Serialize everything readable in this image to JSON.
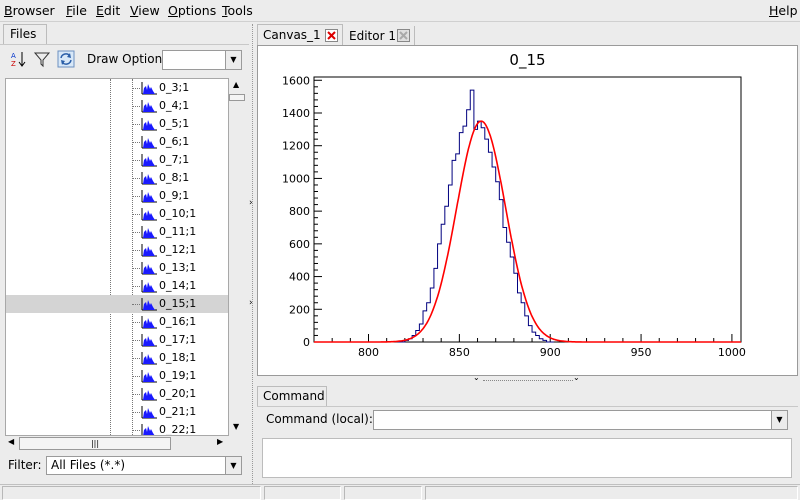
{
  "menu": [
    {
      "label": "Browser"
    },
    {
      "label": "File"
    },
    {
      "label": "Edit"
    },
    {
      "label": "View"
    },
    {
      "label": "Options"
    },
    {
      "label": "Tools"
    }
  ],
  "help_label": "Help",
  "files_tab": "Files",
  "toolbar_icons": [
    "sort-az-icon",
    "filter-funnel-icon",
    "refresh-icon"
  ],
  "draw_option_label": "Draw Option:",
  "draw_option_value": "",
  "tree_items": [
    "0_3;1",
    "0_4;1",
    "0_5;1",
    "0_6;1",
    "0_7;1",
    "0_8;1",
    "0_9;1",
    "0_10;1",
    "0_11;1",
    "0_12;1",
    "0_13;1",
    "0_14;1",
    "0_15;1",
    "0_16;1",
    "0_17;1",
    "0_18;1",
    "0_19;1",
    "0_20;1",
    "0_21;1",
    "0_22;1"
  ],
  "selected_item": "0_15;1",
  "filter_label": "Filter:",
  "filter_value": "All Files (*.*)",
  "tabs": [
    {
      "label": "Canvas_1",
      "active": true
    },
    {
      "label": "Editor 1",
      "active": false
    }
  ],
  "command_tab": "Command",
  "command_label": "Command (local):",
  "command_value": "",
  "colors": {
    "histogram": "#00007f",
    "fit": "#ff0000",
    "selection": "#d4d4d4"
  },
  "chart_data": {
    "type": "histogram",
    "title": "0_15",
    "xlabel": "",
    "ylabel": "",
    "xlim": [
      770,
      1005
    ],
    "ylim": [
      0,
      1620
    ],
    "xticks": [
      800,
      850,
      900,
      950,
      1000
    ],
    "yticks": [
      0,
      200,
      400,
      600,
      800,
      1000,
      1200,
      1400,
      1600
    ],
    "bin_width": 2,
    "bin_start": 816,
    "counts": [
      0,
      0,
      10,
      20,
      40,
      70,
      110,
      190,
      240,
      330,
      450,
      600,
      720,
      830,
      960,
      1110,
      1150,
      1280,
      1320,
      1420,
      1540,
      1300,
      1350,
      1310,
      1240,
      1160,
      1070,
      980,
      870,
      700,
      610,
      520,
      420,
      300,
      240,
      160,
      100,
      60,
      40,
      20,
      10,
      0,
      0
    ],
    "fit": {
      "function": "gaus",
      "mean": 862,
      "sigma": 13.5,
      "amplitude": 1350
    }
  }
}
